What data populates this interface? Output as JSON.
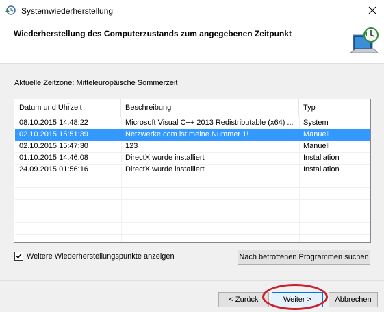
{
  "window": {
    "title": "Systemwiederherstellung",
    "close_label": "✕"
  },
  "header": {
    "title": "Wiederherstellung des Computerzustands zum angegebenen Zeitpunkt"
  },
  "timezone_label": "Aktuelle Zeitzone: Mitteleuropäische Sommerzeit",
  "table": {
    "columns": [
      "Datum und Uhrzeit",
      "Beschreibung",
      "Typ"
    ],
    "rows": [
      {
        "date": "08.10.2015 14:48:22",
        "description": "Microsoft Visual C++ 2013 Redistributable (x64) ...",
        "type": "System"
      },
      {
        "date": "02.10.2015 15:51:39",
        "description": "Netzwerke.com ist meine Nummer 1!",
        "type": "Manuell"
      },
      {
        "date": "02.10.2015 15:47:30",
        "description": "123",
        "type": "Manuell"
      },
      {
        "date": "01.10.2015 14:46:08",
        "description": "DirectX wurde installiert",
        "type": "Installation"
      },
      {
        "date": "24.09.2015 01:56:16",
        "description": "DirectX wurde installiert",
        "type": "Installation"
      }
    ],
    "selected_row": 1
  },
  "more_points_checkbox": {
    "label": "Weitere Wiederherstellungspunkte anzeigen",
    "checked": true
  },
  "buttons": {
    "scan": "Nach betroffenen Programmen suchen",
    "back": "< Zurück",
    "next": "Weiter >",
    "cancel": "Abbrechen"
  },
  "colors": {
    "selection": "#3399ff",
    "highlight_ellipse": "#cc1f2e"
  }
}
